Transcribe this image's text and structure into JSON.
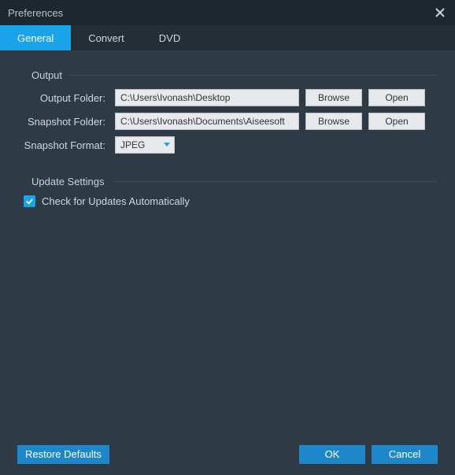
{
  "window": {
    "title": "Preferences"
  },
  "tabs": {
    "general": "General",
    "convert": "Convert",
    "dvd": "DVD"
  },
  "sections": {
    "output": "Output",
    "update": "Update Settings"
  },
  "labels": {
    "output_folder": "Output Folder:",
    "snapshot_folder": "Snapshot Folder:",
    "snapshot_format": "Snapshot Format:",
    "check_updates": "Check for Updates Automatically"
  },
  "values": {
    "output_folder": "C:\\Users\\Ivonash\\Desktop",
    "snapshot_folder": "C:\\Users\\Ivonash\\Documents\\Aiseesoft",
    "snapshot_format": "JPEG"
  },
  "buttons": {
    "browse": "Browse",
    "open": "Open",
    "restore": "Restore Defaults",
    "ok": "OK",
    "cancel": "Cancel"
  },
  "state": {
    "check_updates_checked": true,
    "active_tab": "general"
  },
  "colors": {
    "accent": "#1aa3e8",
    "footer_button": "#1e87c9",
    "background": "#2e3b46",
    "titlebar": "#1e262e",
    "tabbar": "#242e37"
  }
}
